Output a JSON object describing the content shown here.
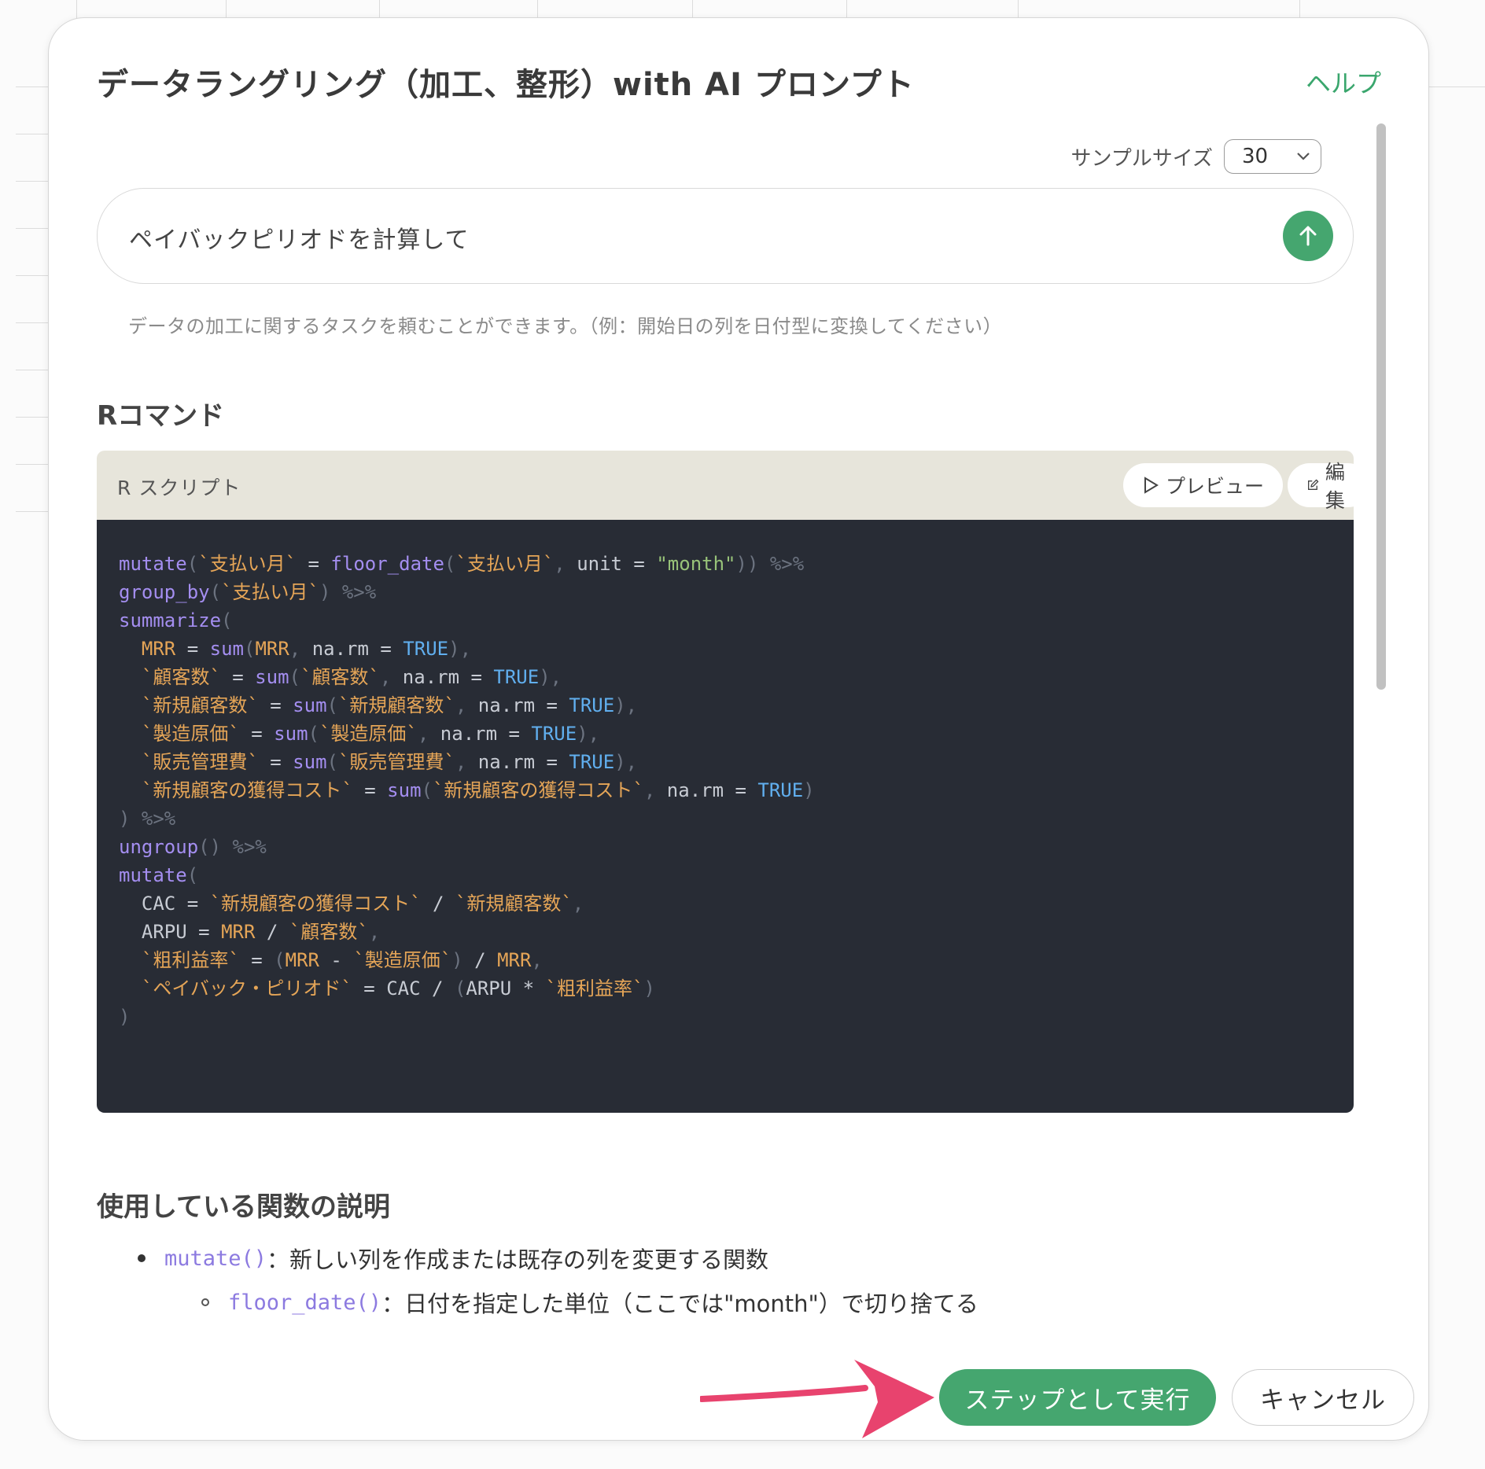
{
  "modal": {
    "title": "データラングリング（加工、整形）with AI プロンプト",
    "help_label": "ヘルプ"
  },
  "sample_size": {
    "label": "サンプルサイズ",
    "value": "30"
  },
  "prompt": {
    "value": "ペイバックピリオドを計算して",
    "hint": "データの加工に関するタスクを頼むことができます。（例：開始日の列を日付型に変換してください）"
  },
  "r_command": {
    "section_title": "Rコマンド",
    "card_label": "R スクリプト",
    "preview_label": "プレビュー",
    "edit_label": "編集",
    "code_lines": [
      "mutate(`支払い月` = floor_date(`支払い月`, unit = \"month\")) %>%",
      "group_by(`支払い月`) %>%",
      "summarize(",
      "  MRR = sum(MRR, na.rm = TRUE),",
      "  `顧客数` = sum(`顧客数`, na.rm = TRUE),",
      "  `新規顧客数` = sum(`新規顧客数`, na.rm = TRUE),",
      "  `製造原価` = sum(`製造原価`, na.rm = TRUE),",
      "  `販売管理費` = sum(`販売管理費`, na.rm = TRUE),",
      "  `新規顧客の獲得コスト` = sum(`新規顧客の獲得コスト`, na.rm = TRUE)",
      ") %>%",
      "ungroup() %>%",
      "mutate(",
      "  CAC = `新規顧客の獲得コスト` / `新規顧客数`,",
      "  ARPU = MRR / `顧客数`,",
      "  `粗利益率` = (MRR - `製造原価`) / MRR,",
      "  `ペイバック・ピリオド` = CAC / (ARPU * `粗利益率`)",
      ")"
    ]
  },
  "functions": {
    "section_title": "使用している関数の説明",
    "items": [
      {
        "code": "mutate()",
        "desc": "：新しい列を作成または既存の列を変更する関数"
      },
      {
        "code": "floor_date()",
        "desc": "：日付を指定した単位（ここでは\"month\"）で切り捨てる"
      }
    ]
  },
  "footer": {
    "execute_label": "ステップとして実行",
    "cancel_label": "キャンセル"
  },
  "colors": {
    "accent_green": "#45a66f",
    "annotation_arrow": "#e8436e",
    "code_bg": "#282c35",
    "code_header_bg": "#e7e5db"
  },
  "icons": [
    "send-arrow-up-icon",
    "chevron-down-icon",
    "play-icon",
    "edit-icon",
    "annotation-arrow-icon"
  ]
}
